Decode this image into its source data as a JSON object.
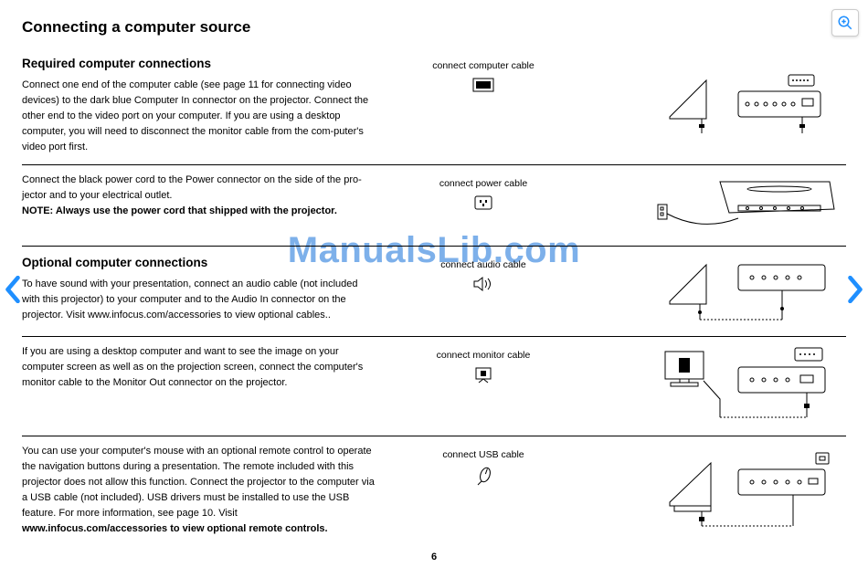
{
  "watermark": "ManualsLib.com",
  "title": "Connecting a computer source",
  "page_number": "6",
  "sections": [
    {
      "heading": "Required computer connections",
      "body": "Connect one end of the computer cable (see page 11 for connecting video devices) to the dark blue Computer In connector on the projector. Connect the other end to the video port on your computer. If you are using a desktop computer, you will need to disconnect the monitor cable from the com-puter's video port first.",
      "caption": "connect computer cable"
    },
    {
      "body": "Connect the black power cord to the Power connector on the side of the pro-jector and to your electrical outlet.",
      "note": "NOTE: Always use the power cord that shipped with the projector.",
      "caption": "connect power cable"
    },
    {
      "heading": "Optional computer connections",
      "body": "To have sound with your presentation, connect an audio cable (not included with this projector) to your computer and to the Audio In connector on the projector. Visit www.infocus.com/accessories to view optional cables..",
      "caption": "connect audio cable"
    },
    {
      "body": "If you are using a desktop computer and want to see the image on your computer screen as well as on the projection screen, connect the computer's monitor cable to the Monitor Out connector on the projector.",
      "caption": "connect monitor cable"
    },
    {
      "body": "You can use your computer's mouse with an optional remote control to operate the navigation buttons during a presentation. The remote included with this projector does not allow this function. Connect the projector to the computer via a USB cable (not included). USB drivers must be installed to use the USB feature. For more information, see page 10. Visit",
      "note": "www.infocus.com/accessories to view optional remote controls.",
      "caption": "connect USB cable"
    }
  ]
}
